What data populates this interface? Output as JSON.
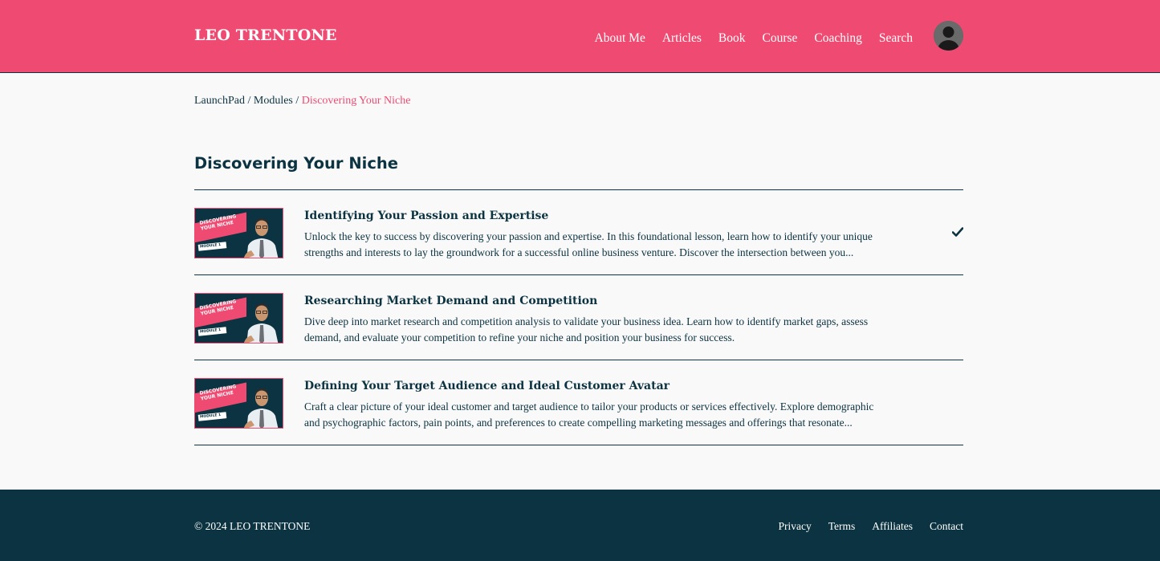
{
  "header": {
    "brand": "LEO TRENTONE",
    "nav": [
      "About Me",
      "Articles",
      "Book",
      "Course",
      "Coaching",
      "Search"
    ]
  },
  "breadcrumb": {
    "items": [
      "LaunchPad",
      "Modules"
    ],
    "separator": "/",
    "current": "Discovering Your Niche"
  },
  "page": {
    "title": "Discovering Your Niche"
  },
  "thumbnail": {
    "line1": "DISCOVERING",
    "line2": "YOUR NICHE",
    "badge": "MODULE 1"
  },
  "lessons": [
    {
      "title": "Identifying Your Passion and Expertise",
      "description": "Unlock the key to success by discovering your passion and expertise. In this foundational lesson, learn how to identify your unique strengths and interests to lay the groundwork for a successful online business venture. Discover the intersection between you...",
      "completed": true
    },
    {
      "title": "Researching Market Demand and Competition",
      "description": "Dive deep into market research and competition analysis to validate your business idea. Learn how to identify market gaps, assess demand, and evaluate your competition to refine your niche and position your business for success.",
      "completed": false
    },
    {
      "title": "Defining Your Target Audience and Ideal Customer Avatar",
      "description": "Craft a clear picture of your ideal customer and target audience to tailor your products or services effectively. Explore demographic and psychographic factors, pain points, and preferences to create compelling marketing messages and offerings that resonate...",
      "completed": false
    }
  ],
  "footer": {
    "copyright": "© 2024 LEO TRENTONE",
    "links": [
      "Privacy",
      "Terms",
      "Affiliates",
      "Contact"
    ]
  },
  "colors": {
    "accent": "#ef4b72",
    "dark": "#0b3341",
    "background": "#f9f9f9"
  },
  "icons": {
    "avatar": "user-avatar-icon",
    "completed": "checkmark-icon"
  }
}
